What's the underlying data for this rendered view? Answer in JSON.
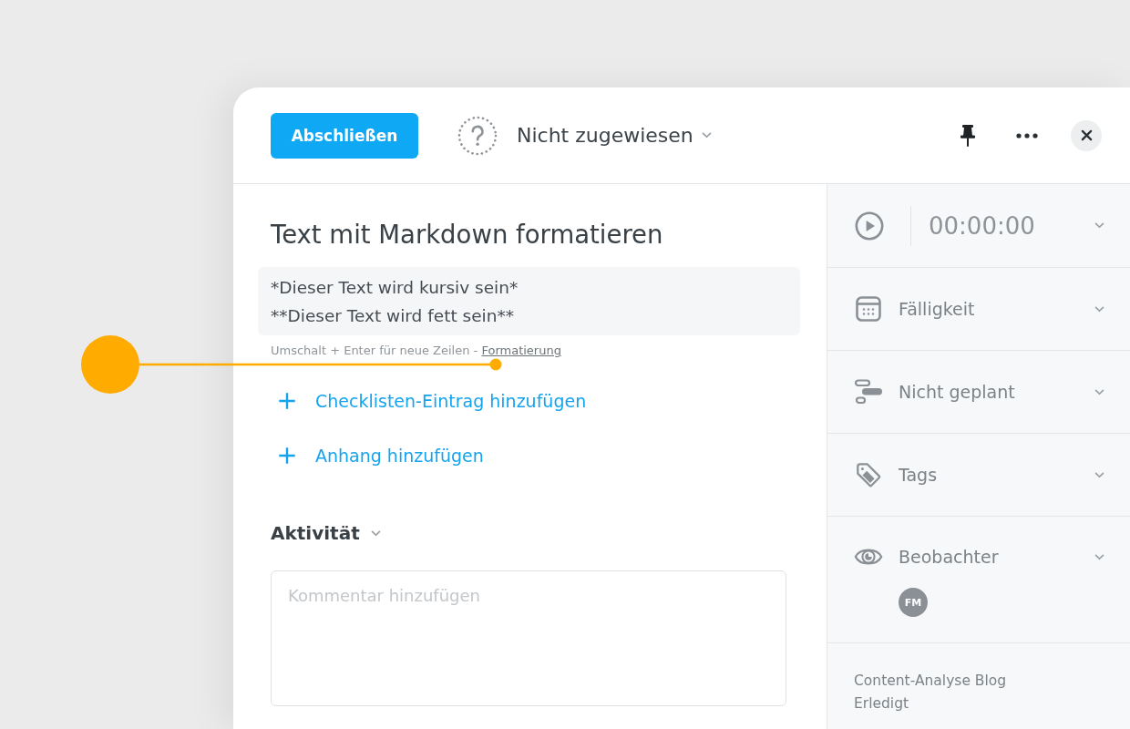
{
  "header": {
    "complete_button": "Abschließen",
    "assignee": "Nicht zugewiesen"
  },
  "task": {
    "title": "Text mit Markdown formatieren",
    "description": [
      "*Dieser Text wird kursiv sein*",
      "**Dieser Text wird fett sein**"
    ],
    "hint": {
      "text": "Umschalt + Enter für neue Zeilen  -",
      "link": "Formatierung"
    }
  },
  "add_actions": [
    "Checklisten-Eintrag hinzufügen",
    "Anhang hinzufügen"
  ],
  "activity": {
    "heading": "Aktivität",
    "comment": {
      "placeholder": "Kommentar hinzufügen"
    }
  },
  "sidebar": {
    "timer": "00:00:00",
    "sections": [
      {
        "kind": "due",
        "label": "Fälligkeit"
      },
      {
        "kind": "schedule",
        "label": "Nicht geplant"
      },
      {
        "kind": "tags",
        "label": "Tags"
      },
      {
        "kind": "watchers",
        "label": "Beobachter",
        "watchers": [
          "FM"
        ]
      }
    ],
    "linked_task": {
      "title": "Content-Analyse Blog",
      "status": "Erledigt"
    }
  }
}
